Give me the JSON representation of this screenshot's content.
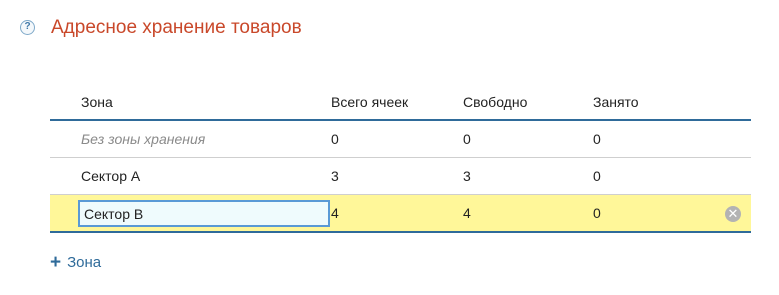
{
  "header": {
    "help_icon_glyph": "?",
    "title": "Адресное хранение товаров"
  },
  "table": {
    "columns": {
      "name": "Зона",
      "total": "Всего ячеек",
      "free": "Свободно",
      "busy": "Занято"
    },
    "rows": [
      {
        "name": "Без зоны хранения",
        "total": "0",
        "free": "0",
        "busy": "0"
      },
      {
        "name": "Сектор А",
        "total": "3",
        "free": "3",
        "busy": "0"
      },
      {
        "name": "Сектор В",
        "total": "4",
        "free": "4",
        "busy": "0"
      }
    ],
    "remove_glyph": "✕"
  },
  "add_zone": {
    "plus_glyph": "+",
    "label": "Зона"
  },
  "colors": {
    "title": "#c9482a",
    "accent": "#2f6b9a",
    "selected_row": "#fff799",
    "input_border": "#5a9ad6"
  },
  "icons": {
    "help": "help-icon",
    "remove": "close-icon",
    "add": "plus-icon"
  }
}
